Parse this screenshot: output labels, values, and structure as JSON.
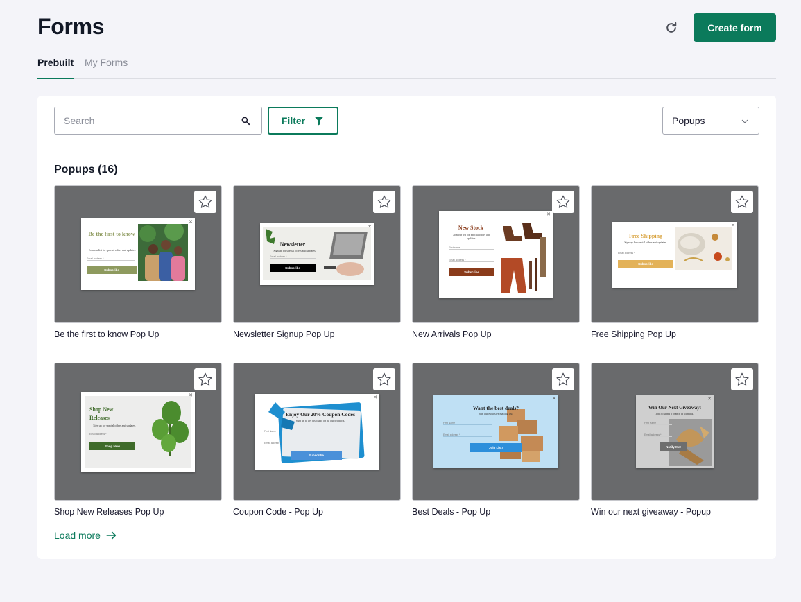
{
  "header": {
    "title": "Forms",
    "create_button": "Create form"
  },
  "tabs": [
    {
      "label": "Prebuilt",
      "active": true
    },
    {
      "label": "My Forms",
      "active": false
    }
  ],
  "toolbar": {
    "search_placeholder": "Search",
    "filter_label": "Filter",
    "type_select_value": "Popups"
  },
  "section": {
    "title": "Popups (16)"
  },
  "cards": [
    {
      "label": "Be the first to know Pop Up",
      "popup_title": "Be the first to know",
      "popup_sub": "Join our list for special offers and updates.",
      "field1": "Email address *",
      "button": "Subscribe"
    },
    {
      "label": "Newsletter Signup Pop Up",
      "popup_title": "Newsletter",
      "popup_sub": "Sign up for special offers and updates.",
      "field1": "Email address *",
      "button": "Subscribe"
    },
    {
      "label": "New Arrivals Pop Up",
      "popup_title": "New Stock",
      "popup_sub": "Join our list for special offers and updates.",
      "field1": "First name",
      "field2": "Email address *",
      "button": "Subscribe"
    },
    {
      "label": "Free Shipping Pop Up",
      "popup_title": "Free Shipping",
      "popup_sub": "Sign up for special offers and updates.",
      "field1": "Email address *",
      "button": "Subscribe"
    },
    {
      "label": "Shop New Releases Pop Up",
      "popup_title": "Shop New Releases",
      "popup_sub": "Sign up for special offers and updates.",
      "field1": "Email address *",
      "button": "Shop Now"
    },
    {
      "label": "Coupon Code - Pop Up",
      "popup_title": "Enjoy Our 20% Coupon Codes",
      "popup_sub": "Sign up to get discounts on all our products.",
      "field1": "First Name",
      "field2": "Email address *",
      "button": "Subscribe"
    },
    {
      "label": "Best Deals - Pop Up",
      "popup_title": "Want the best deals?",
      "popup_sub": "Join our exclusive mailing list.",
      "field1": "First Name",
      "field2": "Email address *",
      "button": "Join List!"
    },
    {
      "label": "Win our next giveaway - Popup",
      "popup_title": "Win Our Next Giveaway!",
      "popup_sub": "Join to stand a chance of winning.",
      "field1": "First Name",
      "field2": "Email address *",
      "button": "Notify Me!"
    }
  ],
  "load_more": "Load more",
  "colors": {
    "accent": "#0b7a5b",
    "thumb_bg": "#696a6c",
    "page_bg": "#f4f4f9"
  },
  "icons": {
    "refresh": "refresh-icon",
    "search": "search-icon",
    "filter": "funnel-icon",
    "select": "chevron-down-icon",
    "favorite": "star-outline-icon",
    "load_more": "arrow-right-icon",
    "close": "close-icon"
  }
}
